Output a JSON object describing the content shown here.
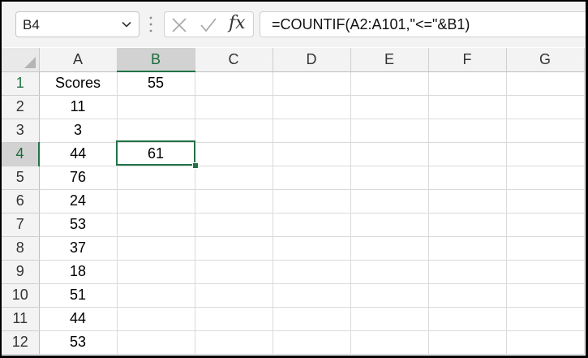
{
  "name_box": {
    "value": "B4"
  },
  "formula_bar": {
    "value": "=COUNTIF(A2:A101,\"<=\"&B1)",
    "fx_label": "fx"
  },
  "columns": [
    "A",
    "B",
    "C",
    "D",
    "E",
    "F",
    "G"
  ],
  "selected_cell": "B4",
  "rows": [
    {
      "num": "1",
      "a": "Scores",
      "b": "55"
    },
    {
      "num": "2",
      "a": "11",
      "b": ""
    },
    {
      "num": "3",
      "a": "3",
      "b": ""
    },
    {
      "num": "4",
      "a": "44",
      "b": "61"
    },
    {
      "num": "5",
      "a": "76",
      "b": ""
    },
    {
      "num": "6",
      "a": "24",
      "b": ""
    },
    {
      "num": "7",
      "a": "53",
      "b": ""
    },
    {
      "num": "8",
      "a": "37",
      "b": ""
    },
    {
      "num": "9",
      "a": "18",
      "b": ""
    },
    {
      "num": "10",
      "a": "51",
      "b": ""
    },
    {
      "num": "11",
      "a": "44",
      "b": ""
    },
    {
      "num": "12",
      "a": "53",
      "b": ""
    }
  ],
  "colors": {
    "accent": "#217346",
    "header_bg": "#f3f3f3",
    "selected_header_bg": "#d2d2d2",
    "gridline": "#dadada"
  }
}
